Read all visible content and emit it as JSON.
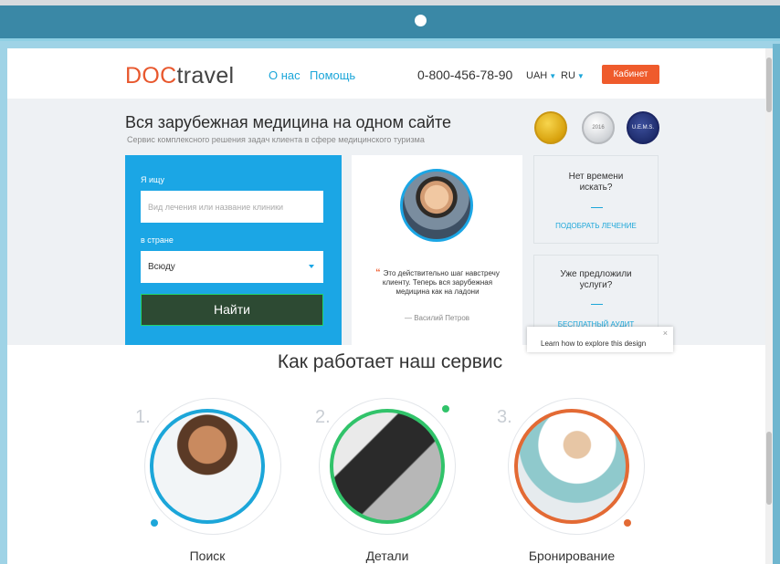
{
  "header": {
    "logo_part1": "DOC",
    "logo_part2": "travel",
    "nav": [
      "О нас",
      "Помощь"
    ],
    "phone": "0-800-456-78-90",
    "currency": "UAH",
    "language": "RU",
    "cabinet_button": "Кабинет"
  },
  "hero": {
    "title": "Вся зарубежная медицина на одном сайте",
    "subtitle": "Сервис комплексного решения задач клиента в сфере медицинского туризма",
    "badges": [
      "",
      "2016",
      "U.E.M.S."
    ],
    "search": {
      "label_search": "Я ищу",
      "placeholder": "Вид лечения или название клиники",
      "label_country": "в стране",
      "country_value": "Всюду",
      "find_button": "Найти"
    },
    "testimonial": {
      "quote_mark": "“",
      "text": "Это действительно шаг навстречу клиенту. Теперь вся зарубежная медицина как на ладони",
      "author": "— Василий Петров"
    },
    "side_cards": [
      {
        "title": "Нет времени искать?",
        "link": "ПОДОБРАТЬ ЛЕЧЕНИЕ"
      },
      {
        "title": "Уже предложили услуги?",
        "link": "БЕСПЛАТНЫЙ АУДИТ"
      }
    ],
    "tooltip": {
      "text": "Learn how to explore this design",
      "close": "×"
    }
  },
  "how": {
    "title": "Как работает наш сервис",
    "steps": [
      {
        "num": "1.",
        "label": "Поиск"
      },
      {
        "num": "2.",
        "label": "Детали"
      },
      {
        "num": "3.",
        "label": "Бронирование"
      }
    ]
  },
  "colors": {
    "accent_blue": "#1ba6e5",
    "accent_orange": "#ef5b2c",
    "accent_green": "#31c36a",
    "chrome": "#3a88a6"
  }
}
